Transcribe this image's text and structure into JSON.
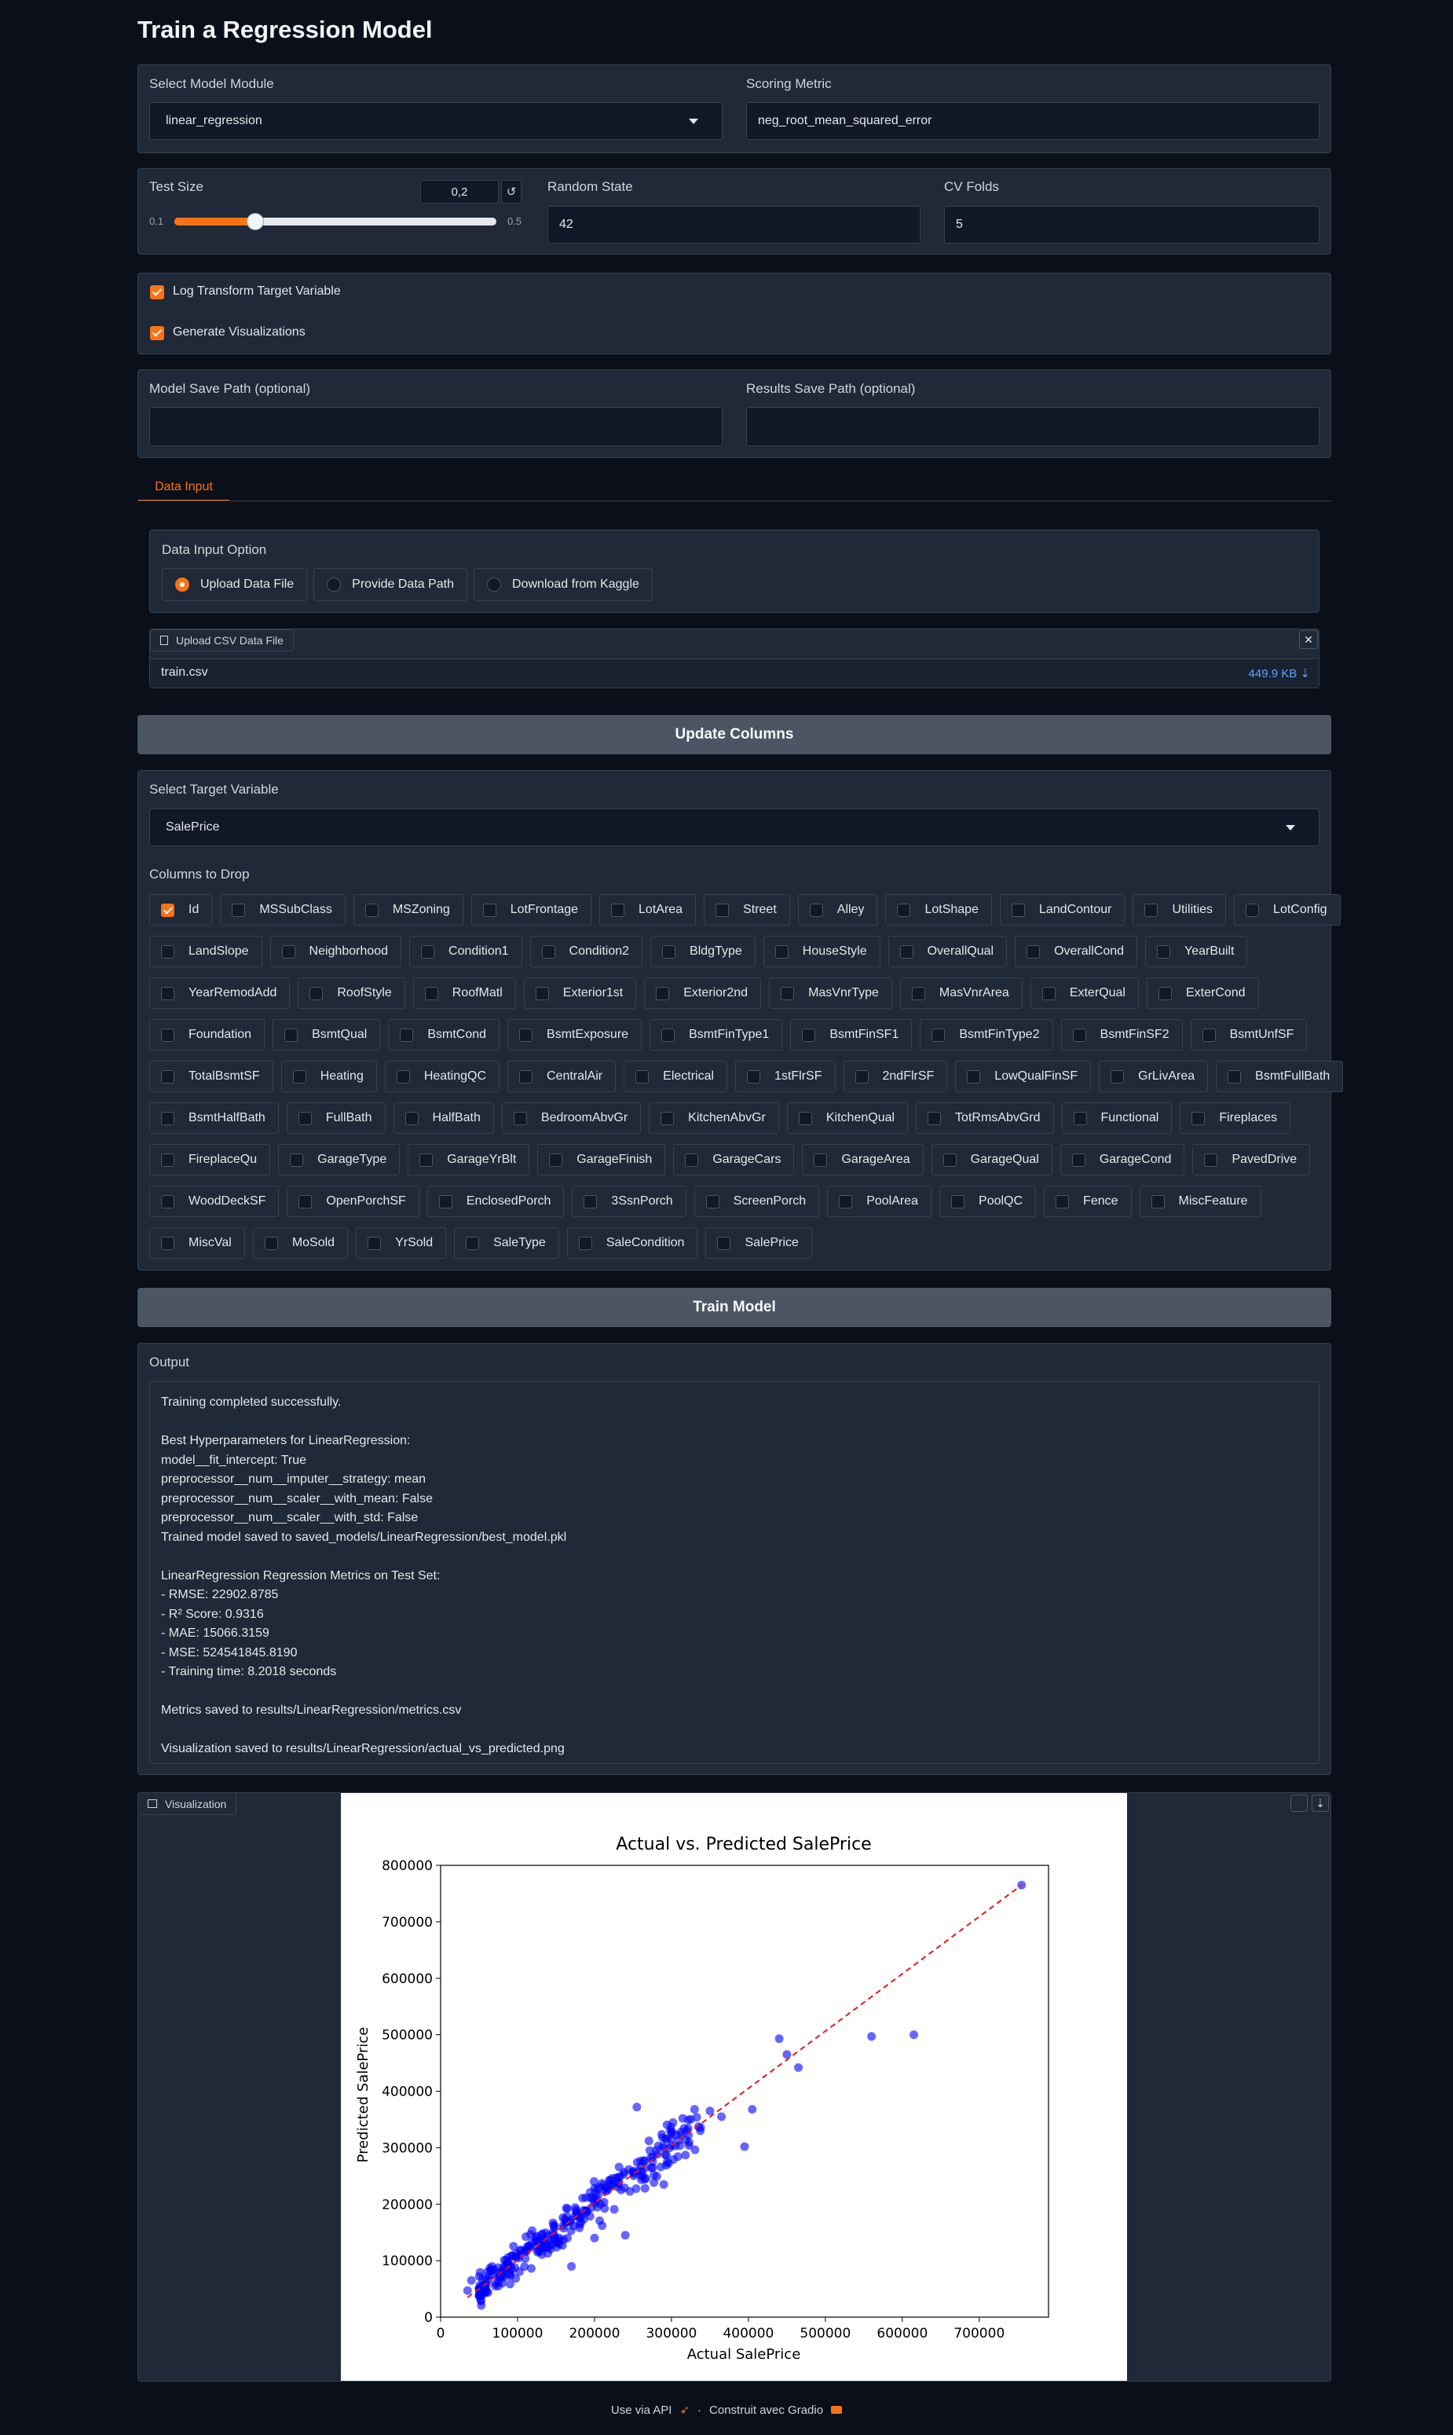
{
  "page_title": "Train a Regression Model",
  "model_module": {
    "label": "Select Model Module",
    "value": "linear_regression"
  },
  "scoring_metric": {
    "label": "Scoring Metric",
    "value": "neg_root_mean_squared_error"
  },
  "test_size": {
    "label": "Test Size",
    "value": "0,2",
    "min": "0.1",
    "max": "0.5",
    "fraction": 0.25,
    "reset_icon": "↺"
  },
  "random_state": {
    "label": "Random State",
    "value": "42"
  },
  "cv_folds": {
    "label": "CV Folds",
    "value": "5"
  },
  "log_transform": {
    "label": "Log Transform Target Variable",
    "checked": true
  },
  "generate_viz": {
    "label": "Generate Visualizations",
    "checked": true
  },
  "model_save_path": {
    "label": "Model Save Path (optional)",
    "value": ""
  },
  "results_save_path": {
    "label": "Results Save Path (optional)",
    "value": ""
  },
  "tabs": [
    {
      "label": "Data Input",
      "active": true
    }
  ],
  "data_input_option": {
    "label": "Data Input Option",
    "options": [
      {
        "label": "Upload Data File",
        "selected": true
      },
      {
        "label": "Provide Data Path",
        "selected": false
      },
      {
        "label": "Download from Kaggle",
        "selected": false
      }
    ]
  },
  "upload": {
    "tag": "Upload CSV Data File",
    "filename": "train.csv",
    "size": "449.9 KB ⇣",
    "close_icon": "✕"
  },
  "update_columns_button": "Update Columns",
  "target_variable": {
    "label": "Select Target Variable",
    "value": "SalePrice"
  },
  "columns_to_drop": {
    "label": "Columns to Drop",
    "rows": [
      [
        [
          "Id",
          true
        ],
        [
          "MSSubClass",
          false
        ],
        [
          "MSZoning",
          false
        ],
        [
          "LotFrontage",
          false
        ],
        [
          "LotArea",
          false
        ],
        [
          "Street",
          false
        ],
        [
          "Alley",
          false
        ],
        [
          "LotShape",
          false
        ],
        [
          "LandContour",
          false
        ],
        [
          "Utilities",
          false
        ],
        [
          "LotConfig",
          false
        ]
      ],
      [
        [
          "LandSlope",
          false
        ],
        [
          "Neighborhood",
          false
        ],
        [
          "Condition1",
          false
        ],
        [
          "Condition2",
          false
        ],
        [
          "BldgType",
          false
        ],
        [
          "HouseStyle",
          false
        ],
        [
          "OverallQual",
          false
        ],
        [
          "OverallCond",
          false
        ],
        [
          "YearBuilt",
          false
        ]
      ],
      [
        [
          "YearRemodAdd",
          false
        ],
        [
          "RoofStyle",
          false
        ],
        [
          "RoofMatl",
          false
        ],
        [
          "Exterior1st",
          false
        ],
        [
          "Exterior2nd",
          false
        ],
        [
          "MasVnrType",
          false
        ],
        [
          "MasVnrArea",
          false
        ],
        [
          "ExterQual",
          false
        ],
        [
          "ExterCond",
          false
        ]
      ],
      [
        [
          "Foundation",
          false
        ],
        [
          "BsmtQual",
          false
        ],
        [
          "BsmtCond",
          false
        ],
        [
          "BsmtExposure",
          false
        ],
        [
          "BsmtFinType1",
          false
        ],
        [
          "BsmtFinSF1",
          false
        ],
        [
          "BsmtFinType2",
          false
        ],
        [
          "BsmtFinSF2",
          false
        ],
        [
          "BsmtUnfSF",
          false
        ]
      ],
      [
        [
          "TotalBsmtSF",
          false
        ],
        [
          "Heating",
          false
        ],
        [
          "HeatingQC",
          false
        ],
        [
          "CentralAir",
          false
        ],
        [
          "Electrical",
          false
        ],
        [
          "1stFlrSF",
          false
        ],
        [
          "2ndFlrSF",
          false
        ],
        [
          "LowQualFinSF",
          false
        ],
        [
          "GrLivArea",
          false
        ],
        [
          "BsmtFullBath",
          false
        ]
      ],
      [
        [
          "BsmtHalfBath",
          false
        ],
        [
          "FullBath",
          false
        ],
        [
          "HalfBath",
          false
        ],
        [
          "BedroomAbvGr",
          false
        ],
        [
          "KitchenAbvGr",
          false
        ],
        [
          "KitchenQual",
          false
        ],
        [
          "TotRmsAbvGrd",
          false
        ],
        [
          "Functional",
          false
        ],
        [
          "Fireplaces",
          false
        ]
      ],
      [
        [
          "FireplaceQu",
          false
        ],
        [
          "GarageType",
          false
        ],
        [
          "GarageYrBlt",
          false
        ],
        [
          "GarageFinish",
          false
        ],
        [
          "GarageCars",
          false
        ],
        [
          "GarageArea",
          false
        ],
        [
          "GarageQual",
          false
        ],
        [
          "GarageCond",
          false
        ],
        [
          "PavedDrive",
          false
        ]
      ],
      [
        [
          "WoodDeckSF",
          false
        ],
        [
          "OpenPorchSF",
          false
        ],
        [
          "EnclosedPorch",
          false
        ],
        [
          "3SsnPorch",
          false
        ],
        [
          "ScreenPorch",
          false
        ],
        [
          "PoolArea",
          false
        ],
        [
          "PoolQC",
          false
        ],
        [
          "Fence",
          false
        ],
        [
          "MiscFeature",
          false
        ]
      ],
      [
        [
          "MiscVal",
          false
        ],
        [
          "MoSold",
          false
        ],
        [
          "YrSold",
          false
        ],
        [
          "SaleType",
          false
        ],
        [
          "SaleCondition",
          false
        ],
        [
          "SalePrice",
          false
        ]
      ]
    ]
  },
  "train_button": "Train Model",
  "output": {
    "label": "Output",
    "lines": [
      "Training completed successfully.",
      "",
      "Best Hyperparameters for LinearRegression:",
      "model__fit_intercept: True",
      "preprocessor__num__imputer__strategy: mean",
      "preprocessor__num__scaler__with_mean: False",
      "preprocessor__num__scaler__with_std: False",
      "Trained model saved to saved_models/LinearRegression/best_model.pkl",
      "",
      "LinearRegression Regression Metrics on Test Set:",
      "- RMSE: 22902.8785",
      "- R² Score: 0.9316",
      "- MAE: 15066.3159",
      "- MSE: 524541845.8190",
      "- Training time: 8.2018 seconds",
      "",
      "Metrics saved to results/LinearRegression/metrics.csv",
      "",
      "Visualization saved to results/LinearRegression/actual_vs_predicted.png"
    ]
  },
  "visualization": {
    "label": "Visualization",
    "icon": "image-icon",
    "actions": [
      "fullscreen-icon",
      "download-icon"
    ]
  },
  "chart_data": {
    "type": "scatter",
    "title": "Actual vs. Predicted SalePrice",
    "xlabel": "Actual SalePrice",
    "ylabel": "Predicted SalePrice",
    "xlim": [
      0,
      790000
    ],
    "ylim": [
      0,
      800000
    ],
    "xticks": [
      "0",
      "100000",
      "200000",
      "300000",
      "400000",
      "500000",
      "600000",
      "700000"
    ],
    "yticks": [
      "0",
      "100000",
      "200000",
      "300000",
      "400000",
      "500000",
      "600000",
      "700000",
      "800000"
    ],
    "point_color": "#0000ff",
    "line_color": "#e41a1c",
    "reference_line": [
      [
        35000,
        35000
      ],
      [
        755000,
        765000
      ]
    ],
    "outliers": [
      [
        35000,
        47000
      ],
      [
        40000,
        65000
      ],
      [
        60000,
        45000
      ],
      [
        75000,
        55000
      ],
      [
        255000,
        372000
      ],
      [
        440000,
        493000
      ],
      [
        450000,
        465000
      ],
      [
        465000,
        442000
      ],
      [
        560000,
        497000
      ],
      [
        615000,
        500000
      ],
      [
        755000,
        765000
      ],
      [
        395000,
        302000
      ],
      [
        405000,
        368000
      ],
      [
        330000,
        368000
      ],
      [
        365000,
        355000
      ],
      [
        350000,
        365000
      ],
      [
        240000,
        145000
      ],
      [
        170000,
        90000
      ],
      [
        290000,
        235000
      ],
      [
        200000,
        140000
      ],
      [
        320000,
        330000
      ],
      [
        300000,
        325000
      ],
      [
        280000,
        295000
      ]
    ],
    "cluster": {
      "n": 300,
      "x_range": [
        50000,
        340000
      ],
      "slope": 1.0,
      "spread": 18000,
      "seed": 7
    }
  },
  "footer": {
    "api": "Use via API",
    "api_icon": "rocket-icon",
    "sep": "·",
    "built": "Construit avec Gradio",
    "gradio_icon": "gradio-icon"
  }
}
